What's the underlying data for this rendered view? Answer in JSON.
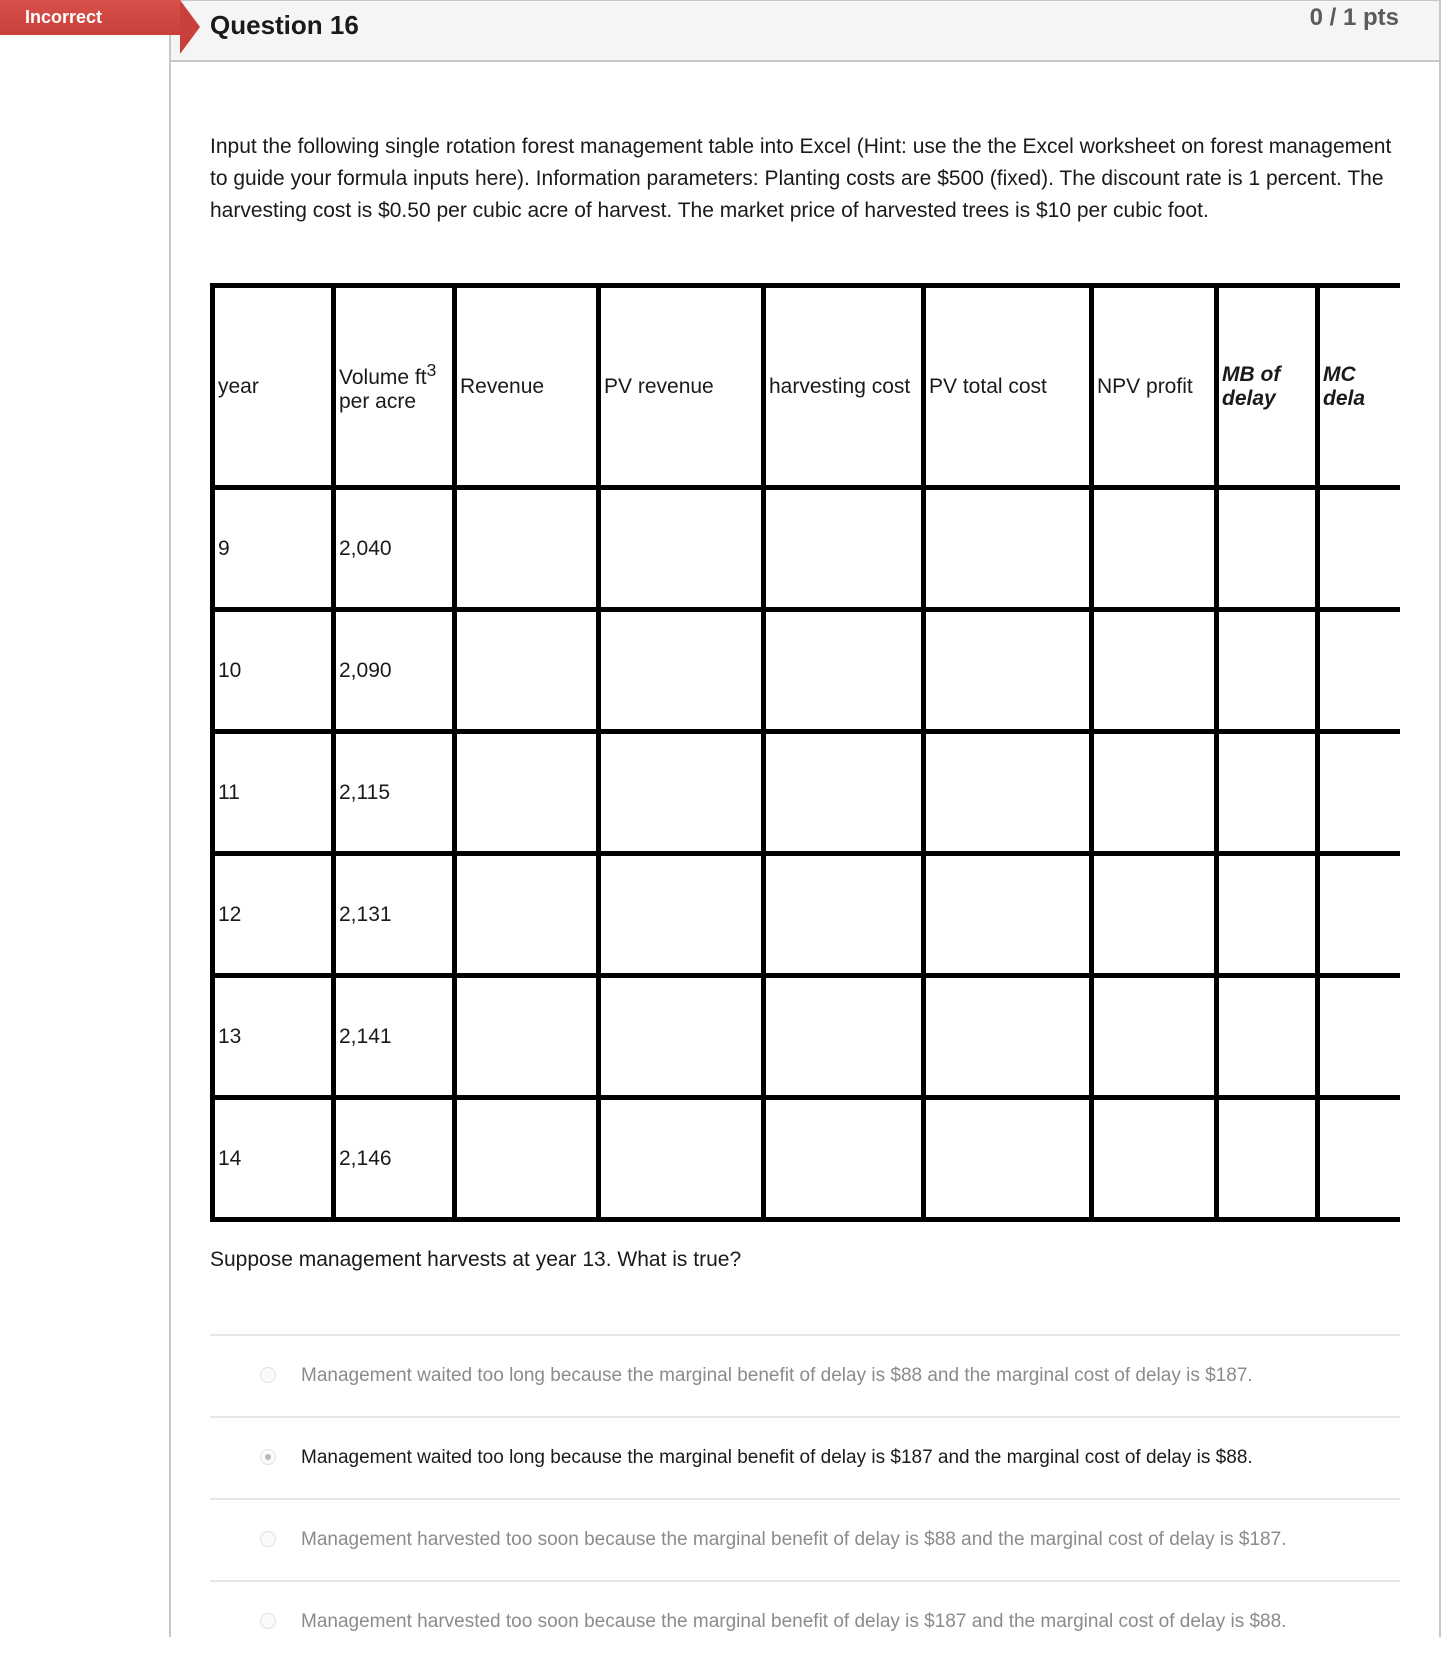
{
  "status": {
    "label": "Incorrect",
    "color": "#c7403a"
  },
  "question": {
    "title": "Question 16",
    "points": "0 / 1 pts",
    "intro": "Input the following single rotation forest management table into Excel (Hint: use the the Excel worksheet on forest management to guide your formula inputs here). Information parameters: Planting costs are $500 (fixed). The discount rate is 1 percent. The harvesting cost is $0.50 per cubic acre of harvest. The market price of harvested trees is $10 per cubic foot.",
    "prompt": "Suppose management harvests at year 13. What is true?"
  },
  "table": {
    "headers": {
      "year": "year",
      "volume_main": "Volume ft",
      "volume_sup": "3",
      "volume_sub": "per acre",
      "revenue": "Revenue",
      "pv_revenue": "PV revenue",
      "harvesting_cost": "harvesting cost",
      "pv_total_cost": "PV total cost",
      "npv_profit": "NPV profit",
      "mb_delay_1": "MB of",
      "mb_delay_2": "delay",
      "mc_delay_1": "MC",
      "mc_delay_2": "dela"
    },
    "rows": [
      {
        "year": "9",
        "volume": "2,040"
      },
      {
        "year": "10",
        "volume": "2,090"
      },
      {
        "year": "11",
        "volume": "2,115"
      },
      {
        "year": "12",
        "volume": "2,131"
      },
      {
        "year": "13",
        "volume": "2,141"
      },
      {
        "year": "14",
        "volume": "2,146"
      }
    ]
  },
  "answers": [
    {
      "label": "Management waited too long because the marginal benefit of delay is $88 and the marginal cost of delay is $187.",
      "selected": false
    },
    {
      "label": "Management waited too long because the marginal benefit of delay is $187 and the marginal cost of delay is $88.",
      "selected": true
    },
    {
      "label": "Management harvested too soon because the marginal benefit of delay is $88 and the marginal cost of delay is $187.",
      "selected": false
    },
    {
      "label": "Management harvested too soon because the marginal benefit of delay is $187 and the marginal cost of delay is $88.",
      "selected": false
    }
  ]
}
